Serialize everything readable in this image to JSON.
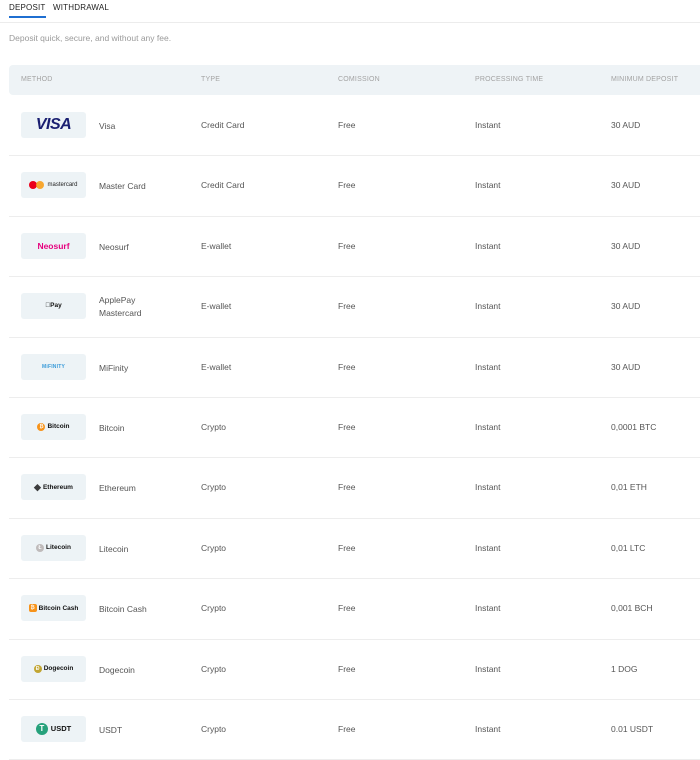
{
  "tabs": [
    {
      "label": "DEPOSIT",
      "active": true
    },
    {
      "label": "WITHDRAWAL",
      "active": false
    }
  ],
  "subtitle": "Deposit quick, secure, and without any fee.",
  "columns": [
    "METHOD",
    "TYPE",
    "COMISSION",
    "PROCESSING TIME",
    "MINIMUM DEPOSIT"
  ],
  "rows": [
    {
      "logo": {
        "text": "VISA",
        "icon": "visa-logo"
      },
      "name": "Visa",
      "type": "Credit Card",
      "commission": "Free",
      "processing": "Instant",
      "minimum": "30 AUD"
    },
    {
      "logo": {
        "text": "mastercard",
        "icon": "mastercard-logo"
      },
      "name": "Master Card",
      "type": "Credit Card",
      "commission": "Free",
      "processing": "Instant",
      "minimum": "30 AUD"
    },
    {
      "logo": {
        "text": "Neosurf",
        "icon": "neosurf-logo"
      },
      "name": "Neosurf",
      "type": "E-wallet",
      "commission": "Free",
      "processing": "Instant",
      "minimum": "30 AUD"
    },
    {
      "logo": {
        "text": "Pay",
        "icon": "applepay-logo"
      },
      "name": [
        "ApplePay",
        "Mastercard"
      ],
      "type": "E-wallet",
      "commission": "Free",
      "processing": "Instant",
      "minimum": "30 AUD"
    },
    {
      "logo": {
        "text": "MiFINITY",
        "icon": "mifinity-logo"
      },
      "name": "MiFinity",
      "type": "E-wallet",
      "commission": "Free",
      "processing": "Instant",
      "minimum": "30 AUD"
    },
    {
      "logo": {
        "text": "Bitcoin",
        "icon": "bitcoin-logo",
        "color": "#f7931a"
      },
      "name": "Bitcoin",
      "type": "Crypto",
      "commission": "Free",
      "processing": "Instant",
      "minimum": "0,0001 BTC"
    },
    {
      "logo": {
        "text": "Ethereum",
        "icon": "ethereum-logo",
        "color": "#3c3c3d"
      },
      "name": "Ethereum",
      "type": "Crypto",
      "commission": "Free",
      "processing": "Instant",
      "minimum": "0,01 ETH"
    },
    {
      "logo": {
        "text": "Litecoin",
        "icon": "litecoin-logo",
        "color": "#bfbbbb"
      },
      "name": "Litecoin",
      "type": "Crypto",
      "commission": "Free",
      "processing": "Instant",
      "minimum": "0,01 LTC"
    },
    {
      "logo": {
        "text": "Bitcoin Cash",
        "icon": "bitcoin-cash-logo",
        "color": "#f7931a"
      },
      "name": "Bitcoin Cash",
      "type": "Crypto",
      "commission": "Free",
      "processing": "Instant",
      "minimum": "0,001 BCH"
    },
    {
      "logo": {
        "text": "Dogecoin",
        "icon": "dogecoin-logo",
        "color": "#c2a633"
      },
      "name": "Dogecoin",
      "type": "Crypto",
      "commission": "Free",
      "processing": "Instant",
      "minimum": "1 DOG"
    },
    {
      "logo": {
        "text": "USDT",
        "icon": "usdt-logo",
        "color": "#26a17b"
      },
      "name": "USDT",
      "type": "Crypto",
      "commission": "Free",
      "processing": "Instant",
      "minimum": "0.01 USDT"
    }
  ]
}
